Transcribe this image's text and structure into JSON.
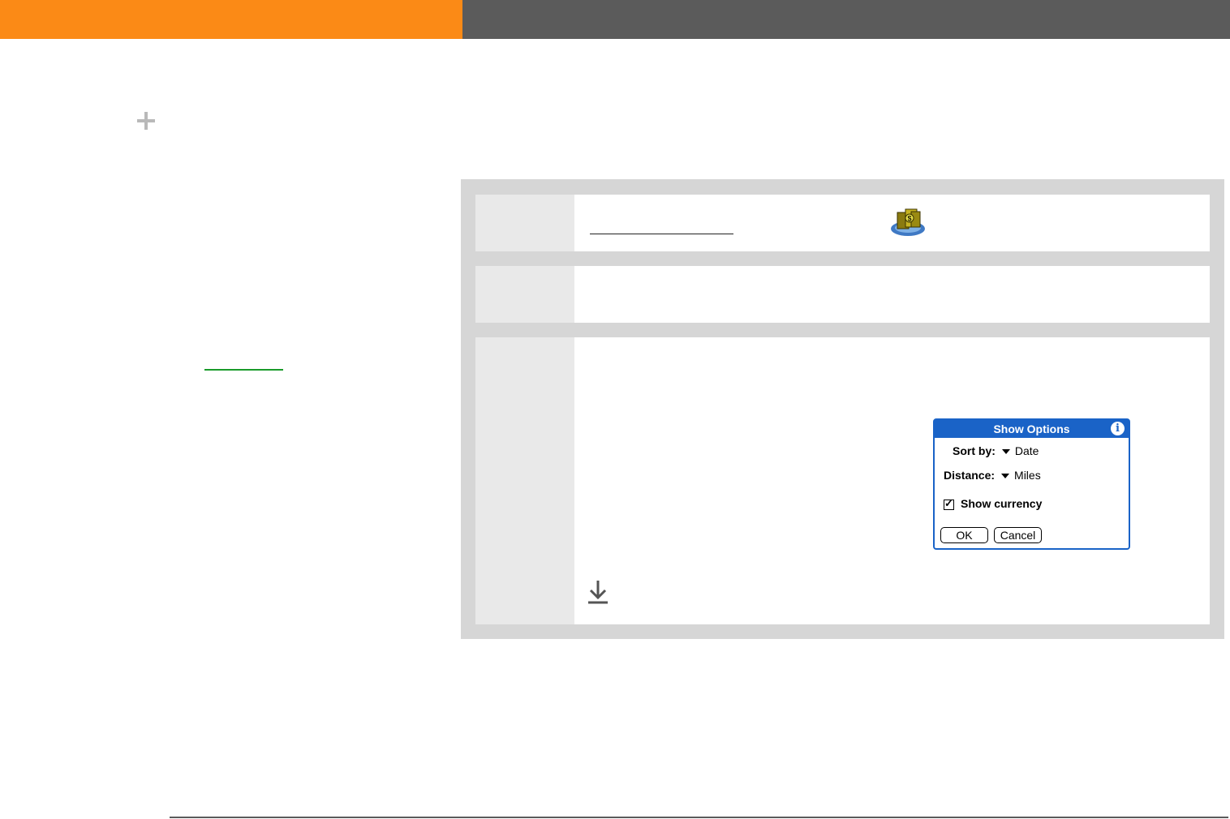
{
  "colors": {
    "header_accent": "#fb8a16",
    "header_bar": "#5b5b5b",
    "dialog_blue": "#1a63c7",
    "link_green": "#1a9b2a"
  },
  "icons": [
    "plus-icon",
    "expense-app-icon",
    "info-icon",
    "download-arrow-icon"
  ],
  "dialog": {
    "title": "Show Options",
    "sort_label": "Sort by:",
    "sort_value": "Date",
    "distance_label": "Distance:",
    "distance_value": "Miles",
    "currency_label": "Show currency",
    "show_currency_checked": true,
    "ok_label": "OK",
    "cancel_label": "Cancel"
  }
}
